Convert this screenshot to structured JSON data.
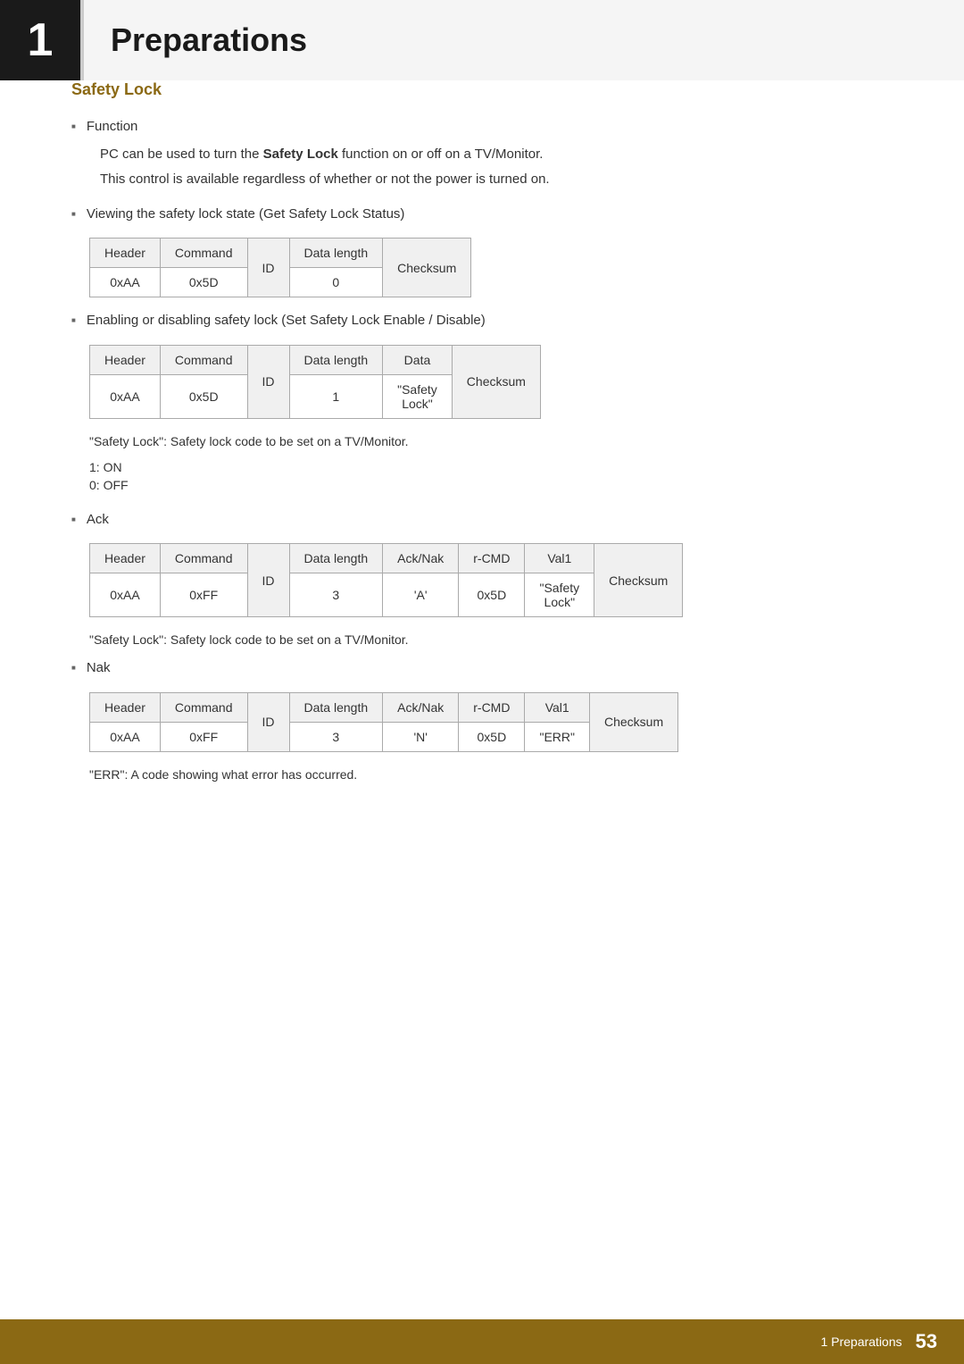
{
  "header": {
    "chapter_number": "1",
    "chapter_title": "Preparations"
  },
  "footer": {
    "section_label": "1 Preparations",
    "page_number": "53"
  },
  "section": {
    "title": "Safety Lock",
    "bullets": [
      {
        "id": "function",
        "label": "Function",
        "lines": [
          "PC can be used to turn the Safety Lock function on or off on a TV/Monitor.",
          "This control is available regardless of whether or not the power is turned on."
        ]
      },
      {
        "id": "viewing",
        "label": "Viewing the safety lock state (Get Safety Lock Status)"
      },
      {
        "id": "enabling",
        "label": "Enabling or disabling safety lock (Set Safety Lock Enable / Disable)"
      },
      {
        "id": "ack",
        "label": "Ack"
      },
      {
        "id": "nak",
        "label": "Nak"
      }
    ],
    "table_viewing": {
      "headers": [
        "Header",
        "Command",
        "ID",
        "Data length",
        "Checksum"
      ],
      "row": [
        "0xAA",
        "0x5D",
        "",
        "0",
        ""
      ]
    },
    "table_enabling": {
      "headers": [
        "Header",
        "Command",
        "ID",
        "Data length",
        "Data",
        ""
      ],
      "row": [
        "0xAA",
        "0x5D",
        "",
        "1",
        "\"Safety Lock\"",
        "Checksum"
      ]
    },
    "table_ack": {
      "headers": [
        "Header",
        "Command",
        "ID",
        "Data length",
        "Ack/Nak",
        "r-CMD",
        "Val1",
        ""
      ],
      "row": [
        "0xAA",
        "0xFF",
        "",
        "3",
        "‘A’",
        "0x5D",
        "\"Safety Lock\"",
        "Checksum"
      ]
    },
    "table_nak": {
      "headers": [
        "Header",
        "Command",
        "ID",
        "Data length",
        "Ack/Nak",
        "r-CMD",
        "Val1",
        ""
      ],
      "row": [
        "0xAA",
        "0xFF",
        "",
        "3",
        "‘N’",
        "0x5D",
        "\"ERR\"",
        "Checksum"
      ]
    },
    "notes": {
      "safety_lock_code": "\"Safety Lock\": Safety lock code to be set on a TV/Monitor.",
      "on": "1: ON",
      "off": "0: OFF",
      "safety_lock_code_ack": "\"Safety Lock\": Safety lock code to be set on a TV/Monitor.",
      "err_note": "\"ERR\": A code showing what error has occurred."
    }
  }
}
